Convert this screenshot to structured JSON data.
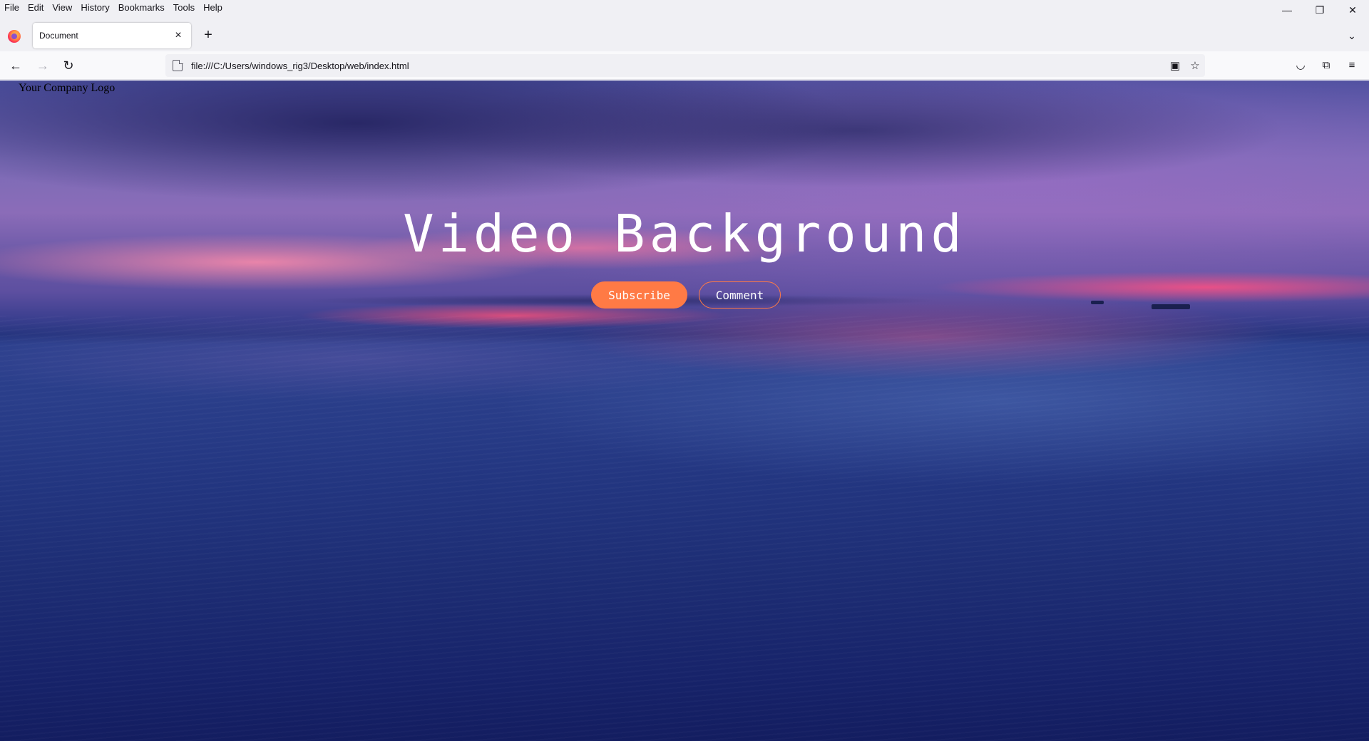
{
  "browser": {
    "menu": [
      "File",
      "Edit",
      "View",
      "History",
      "Bookmarks",
      "Tools",
      "Help"
    ],
    "tab": {
      "title": "Document",
      "close_icon": "×"
    },
    "new_tab_icon": "+",
    "url": "file:///C:/Users/windows_rig3/Desktop/web/index.html",
    "icons": {
      "back": "←",
      "forward": "→",
      "reload": "↻",
      "minimize": "—",
      "restore": "❐",
      "close": "✕",
      "tablist": "⌄",
      "pip": "▣",
      "bookmark_star": "☆",
      "pocket": "◡",
      "extensions": "⧉",
      "menu": "≡"
    }
  },
  "page": {
    "logo": "Your Company Logo",
    "hero_title": "Video Background",
    "buttons": {
      "subscribe": "Subscribe",
      "comment": "Comment"
    },
    "colors": {
      "accent": "#ff7a45",
      "text": "#ffffff"
    }
  }
}
